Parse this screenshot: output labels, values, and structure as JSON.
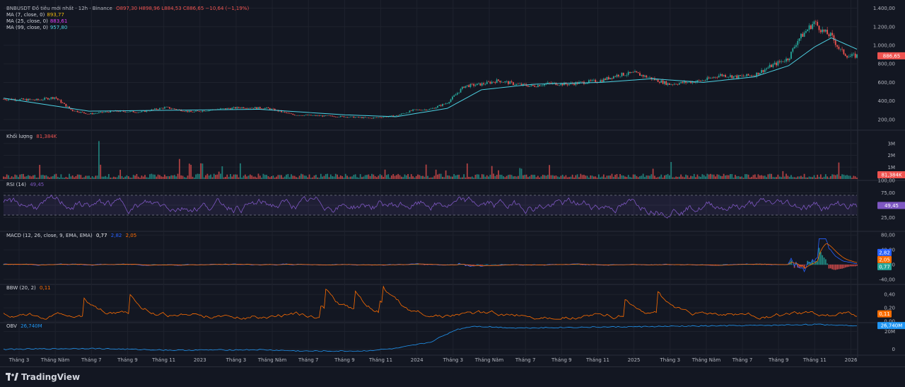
{
  "header": {
    "symbol": "BNBUSDT Đồ tiêu mới nhất · 12h · Binance",
    "ohlc": "O897,30 H898,96 L884,53 C886,65 −10,64 (−1,19%)",
    "ma7_label": "MA (7, close, 0)",
    "ma7_value": "893,77",
    "ma25_label": "MA (25, close, 0)",
    "ma25_value": "883,61",
    "ma99_label": "MA (99, close, 0)",
    "ma99_value": "957,80"
  },
  "panels": {
    "volume_label": "Khối lượng",
    "volume_value": "81,384K",
    "rsi_label": "RSI (14)",
    "rsi_value": "49,45",
    "macd_label": "MACD (12, 26, close, 9, EMA, EMA)",
    "macd_v1": "0,77",
    "macd_v2": "2,82",
    "macd_v3": "2,05",
    "bbw_label": "BBW (20, 2)",
    "bbw_value": "0,11",
    "obv_label": "OBV",
    "obv_value": "26,740M"
  },
  "brand": "TradingView",
  "colors": {
    "background": "#131722",
    "grid": "#1e222d",
    "up": "#26a69a",
    "down": "#ef5350",
    "ma7": "#f0b90b",
    "ma25": "#e040fb",
    "ma99": "#4dd0e1",
    "rsi": "#7e57c2",
    "macd": "#2962ff",
    "signal": "#ff6d00",
    "bbw": "#ff6d00",
    "obv": "#2196f3"
  },
  "chart_data": {
    "type": "line",
    "x_ticks": [
      "Tháng 3",
      "Tháng Năm",
      "Tháng 7",
      "Tháng 9",
      "Tháng 11",
      "2023",
      "Tháng 3",
      "Tháng Năm",
      "Tháng 7",
      "Tháng 9",
      "Tháng 11",
      "2024",
      "Tháng 3",
      "Tháng Năm",
      "Tháng 7",
      "Tháng 9",
      "Tháng 11",
      "2025",
      "Tháng 3",
      "Tháng Năm",
      "Tháng 7",
      "Tháng 9",
      "Tháng 11",
      "2026"
    ],
    "price": {
      "y_ticks": [
        "1.400,00",
        "1.200,00",
        "1.000,00",
        "800,00",
        "600,00",
        "400,00",
        "200,00"
      ],
      "y_values": [
        1400,
        1200,
        1000,
        800,
        600,
        400,
        200
      ],
      "ylim": [
        100,
        1450
      ],
      "last_label": "886,65",
      "series": [
        {
          "x": 0.0,
          "y": 420
        },
        {
          "x": 0.04,
          "y": 410
        },
        {
          "x": 0.06,
          "y": 440
        },
        {
          "x": 0.08,
          "y": 300
        },
        {
          "x": 0.1,
          "y": 260
        },
        {
          "x": 0.13,
          "y": 290
        },
        {
          "x": 0.16,
          "y": 280
        },
        {
          "x": 0.19,
          "y": 330
        },
        {
          "x": 0.22,
          "y": 280
        },
        {
          "x": 0.25,
          "y": 310
        },
        {
          "x": 0.28,
          "y": 330
        },
        {
          "x": 0.31,
          "y": 320
        },
        {
          "x": 0.34,
          "y": 250
        },
        {
          "x": 0.37,
          "y": 240
        },
        {
          "x": 0.4,
          "y": 230
        },
        {
          "x": 0.43,
          "y": 215
        },
        {
          "x": 0.46,
          "y": 240
        },
        {
          "x": 0.48,
          "y": 300
        },
        {
          "x": 0.5,
          "y": 310
        },
        {
          "x": 0.52,
          "y": 380
        },
        {
          "x": 0.54,
          "y": 560
        },
        {
          "x": 0.56,
          "y": 580
        },
        {
          "x": 0.58,
          "y": 620
        },
        {
          "x": 0.6,
          "y": 580
        },
        {
          "x": 0.62,
          "y": 560
        },
        {
          "x": 0.64,
          "y": 590
        },
        {
          "x": 0.66,
          "y": 580
        },
        {
          "x": 0.68,
          "y": 600
        },
        {
          "x": 0.7,
          "y": 620
        },
        {
          "x": 0.72,
          "y": 680
        },
        {
          "x": 0.74,
          "y": 700
        },
        {
          "x": 0.76,
          "y": 640
        },
        {
          "x": 0.78,
          "y": 580
        },
        {
          "x": 0.8,
          "y": 600
        },
        {
          "x": 0.82,
          "y": 620
        },
        {
          "x": 0.84,
          "y": 680
        },
        {
          "x": 0.86,
          "y": 660
        },
        {
          "x": 0.88,
          "y": 680
        },
        {
          "x": 0.9,
          "y": 780
        },
        {
          "x": 0.92,
          "y": 860
        },
        {
          "x": 0.93,
          "y": 1050
        },
        {
          "x": 0.95,
          "y": 1250
        },
        {
          "x": 0.96,
          "y": 1150
        },
        {
          "x": 0.97,
          "y": 1100
        },
        {
          "x": 0.98,
          "y": 950
        },
        {
          "x": 0.99,
          "y": 880
        },
        {
          "x": 1.0,
          "y": 887
        }
      ],
      "ma_long": [
        {
          "x": 0.0,
          "y": 430
        },
        {
          "x": 0.1,
          "y": 290
        },
        {
          "x": 0.2,
          "y": 300
        },
        {
          "x": 0.3,
          "y": 310
        },
        {
          "x": 0.4,
          "y": 250
        },
        {
          "x": 0.46,
          "y": 230
        },
        {
          "x": 0.52,
          "y": 320
        },
        {
          "x": 0.56,
          "y": 520
        },
        {
          "x": 0.62,
          "y": 580
        },
        {
          "x": 0.7,
          "y": 600
        },
        {
          "x": 0.76,
          "y": 640
        },
        {
          "x": 0.82,
          "y": 600
        },
        {
          "x": 0.88,
          "y": 660
        },
        {
          "x": 0.92,
          "y": 780
        },
        {
          "x": 0.95,
          "y": 980
        },
        {
          "x": 0.97,
          "y": 1080
        },
        {
          "x": 1.0,
          "y": 958
        }
      ]
    },
    "volume": {
      "y_ticks": [
        "3M",
        "2M",
        "1M"
      ],
      "y_values": [
        3,
        2,
        1
      ],
      "ylim": [
        0,
        4
      ]
    },
    "rsi": {
      "y_ticks": [
        "100,00",
        "75,00",
        "50,00",
        "25,00"
      ],
      "y_values": [
        100,
        75,
        50,
        25
      ],
      "ylim": [
        0,
        100
      ],
      "bands": [
        30,
        70
      ]
    },
    "macd": {
      "y_ticks": [
        "80,00",
        "40,00",
        "0,00",
        "-40,00"
      ],
      "y_values": [
        80,
        40,
        0,
        -40
      ],
      "ylim": [
        -50,
        90
      ]
    },
    "bbw": {
      "y_ticks": [
        "0,40",
        "0,20",
        "0,00"
      ],
      "y_values": [
        0.4,
        0.2,
        0.0
      ],
      "ylim": [
        0,
        0.55
      ]
    },
    "obv": {
      "y_ticks": [
        "20M",
        "0"
      ],
      "y_values": [
        20,
        0
      ],
      "ylim": [
        -5,
        30
      ],
      "series": [
        {
          "x": 0.0,
          "y": 0
        },
        {
          "x": 0.1,
          "y": 1
        },
        {
          "x": 0.2,
          "y": -1
        },
        {
          "x": 0.3,
          "y": -0.5
        },
        {
          "x": 0.35,
          "y": -2
        },
        {
          "x": 0.42,
          "y": -2
        },
        {
          "x": 0.46,
          "y": 1
        },
        {
          "x": 0.5,
          "y": 8
        },
        {
          "x": 0.53,
          "y": 22
        },
        {
          "x": 0.55,
          "y": 26
        },
        {
          "x": 0.6,
          "y": 24
        },
        {
          "x": 0.7,
          "y": 25
        },
        {
          "x": 0.8,
          "y": 26
        },
        {
          "x": 0.9,
          "y": 27
        },
        {
          "x": 0.95,
          "y": 28
        },
        {
          "x": 1.0,
          "y": 26.7
        }
      ]
    }
  }
}
